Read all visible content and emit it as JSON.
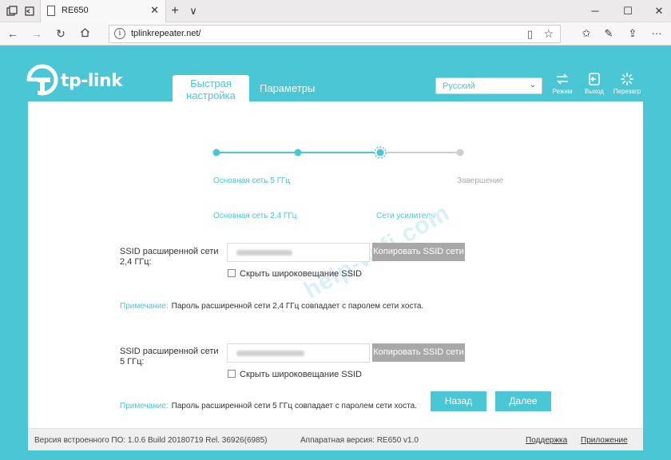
{
  "browser": {
    "tab_title": "RE650",
    "url": "tplinkrepeater.net/",
    "new_tab_symbol": "+",
    "tab_list_symbol": "∨"
  },
  "header": {
    "logo_text": "tp-link",
    "tabs": [
      {
        "label_line1": "Быстрая",
        "label_line2": "настройка"
      },
      {
        "label": "Параметры"
      }
    ],
    "language": "Русский",
    "actions": [
      {
        "label": "Режим",
        "icon": "mode-icon"
      },
      {
        "label": "Выход",
        "icon": "logout-icon"
      },
      {
        "label": "Перезагр",
        "icon": "reboot-icon"
      }
    ]
  },
  "wizard": {
    "steps": [
      {
        "label": "Основная сеть 2,4 ГГц",
        "state": "done"
      },
      {
        "label": "Основная сеть 5 ГГц",
        "state": "done"
      },
      {
        "label": "Сети усилителя",
        "state": "current"
      },
      {
        "label": "Завершение",
        "state": "pending"
      }
    ]
  },
  "form": {
    "ssid24": {
      "label_line1": "SSID расширенной сети",
      "label_line2": "2,4 ГГц:",
      "copy_label": "Копировать SSID сети",
      "hide_label": "Скрыть широковещание SSID"
    },
    "note24": {
      "title": "Примечание:",
      "text": "Пароль расширенной сети 2,4 ГГц совпадает с паролем сети хоста."
    },
    "ssid5": {
      "label_line1": "SSID расширенной сети",
      "label_line2": "5 ГГц:",
      "copy_label": "Копировать SSID сети",
      "hide_label": "Скрыть широковещание SSID"
    },
    "note5": {
      "title": "Примечание:",
      "text": "Пароль расширенной сети 5 ГГц совпадает с паролем сети хоста."
    },
    "back_label": "Назад",
    "next_label": "Далее"
  },
  "watermark": "help-wifi.com",
  "footer": {
    "firmware": "Версия встроенного ПО: 1.0.6 Build 20180719 Rel. 36926(6985)",
    "hardware": "Аппаратная версия: RE650 v1.0",
    "support_label": "Поддержка",
    "app_label": "Приложение"
  },
  "colors": {
    "accent": "#4bc6d4",
    "disabled_button": "#a8a8a8"
  }
}
